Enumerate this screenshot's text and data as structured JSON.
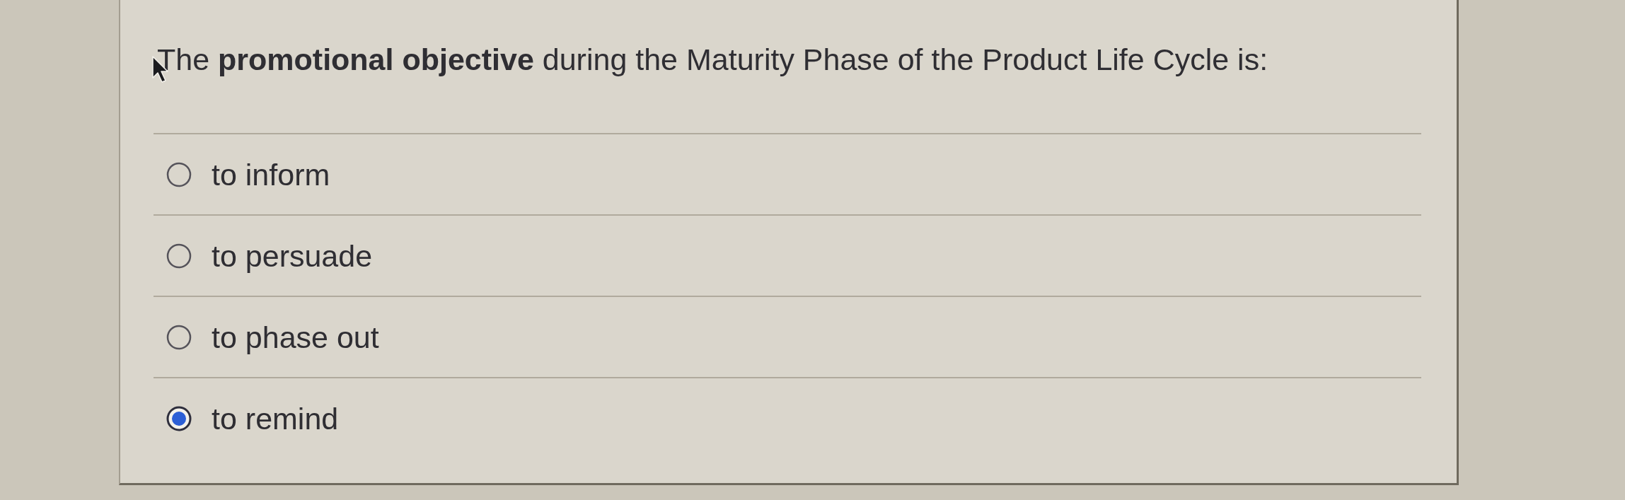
{
  "question": {
    "text": "The **promotional objective** during the Maturity Phase of the Product Life Cycle is:"
  },
  "options": [
    {
      "label": "to inform",
      "selected": false
    },
    {
      "label": "to persuade",
      "selected": false
    },
    {
      "label": "to phase out",
      "selected": false
    },
    {
      "label": "to remind",
      "selected": true
    }
  ]
}
